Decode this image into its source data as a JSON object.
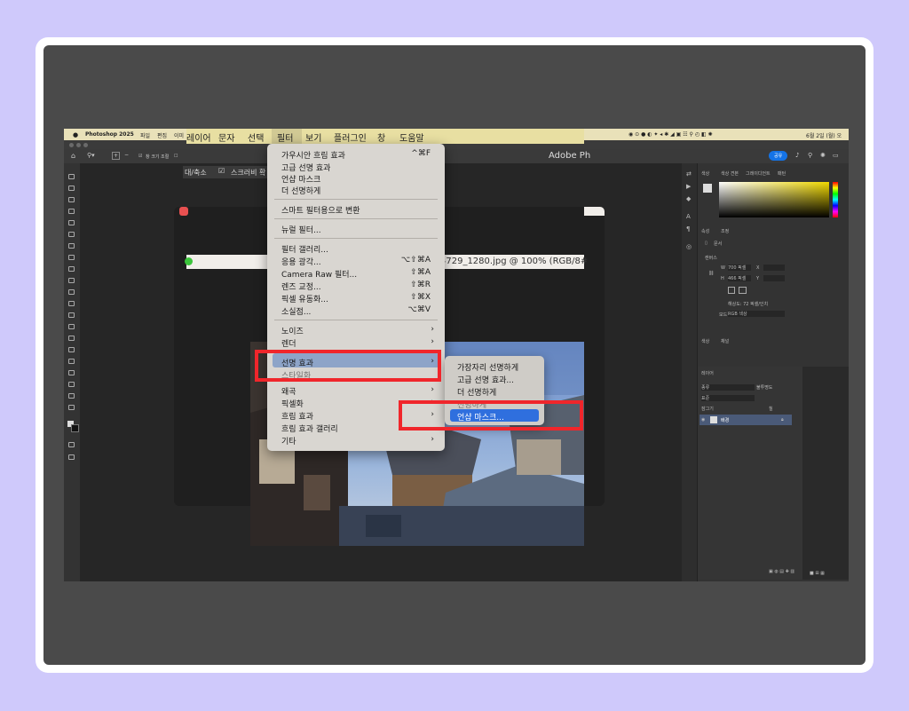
{
  "ps_menubar": {
    "app": "Photoshop 2025",
    "file": "파일",
    "edit": "편집",
    "image": "이미",
    "date": "6월 2일 (월) 오"
  },
  "big_menubar": {
    "items": [
      "레이어",
      "문자",
      "선택",
      "필터",
      "보기",
      "플러그인",
      "창",
      "도움말"
    ]
  },
  "app_title": "Adobe Ph",
  "options_bar": {
    "zoom_all": "창 크기 조절",
    "zoom_fit": "대/축소",
    "scrubby": "스크러비 확"
  },
  "document": {
    "tab_title": "4729_1280.jpg @ 100% (RGB/8#"
  },
  "share_button": "공유",
  "filter_menu": {
    "items": [
      {
        "label": "가우시안 흐림 효과",
        "shortcut": "^⌘F"
      },
      {
        "label": "고급 선명 효과",
        "shortcut": ""
      },
      {
        "label": "언샵 마스크",
        "shortcut": ""
      },
      {
        "label": "더 선명하게",
        "shortcut": ""
      },
      {
        "label": "스마트 필터용으로 변환",
        "shortcut": ""
      },
      {
        "label": "뉴럴 필터...",
        "shortcut": ""
      },
      {
        "label": "필터 갤러리...",
        "shortcut": ""
      },
      {
        "label": "응용 광각...",
        "shortcut": "⌥⇧⌘A"
      },
      {
        "label": "Camera Raw 필터...",
        "shortcut": "⇧⌘A"
      },
      {
        "label": "렌즈 교정...",
        "shortcut": "⇧⌘R"
      },
      {
        "label": "픽셀 유동화...",
        "shortcut": "⇧⌘X"
      },
      {
        "label": "소실점...",
        "shortcut": "⌥⌘V"
      },
      {
        "label": "노이즈",
        "shortcut": ""
      },
      {
        "label": "렌더",
        "shortcut": ""
      },
      {
        "label": "선명 효과",
        "shortcut": ""
      },
      {
        "label": "스타일화",
        "shortcut": ""
      },
      {
        "label": "왜곡",
        "shortcut": ""
      },
      {
        "label": "픽셀화",
        "shortcut": ""
      },
      {
        "label": "흐림 효과",
        "shortcut": ""
      },
      {
        "label": "흐림 효과 갤러리",
        "shortcut": ""
      },
      {
        "label": "기타",
        "shortcut": ""
      }
    ]
  },
  "sharpen_submenu": {
    "items": [
      "가장자리 선명하게",
      "고급 선명 효과...",
      "더 선명하게",
      "선명하게",
      "언샵 마스크..."
    ]
  },
  "right_panel": {
    "color_tabs": [
      "색상",
      "색상 견본",
      "그레이디언트",
      "패턴"
    ],
    "props_tabs": [
      "속성",
      "조정"
    ],
    "doc_label": "문서",
    "canvas_label": "캔버스",
    "width_label": "W",
    "width_value": "700 픽셀",
    "height_label": "H",
    "height_value": "466 픽셀",
    "x_label": "X",
    "y_label": "Y",
    "resolution": "해상도: 72 픽셀/인치",
    "mode_label": "모드",
    "mode_value": "RGB 색상",
    "history_tabs": [
      "색상",
      "채널"
    ],
    "layers_tab": "레이어",
    "filter_placeholder": "종류",
    "blend_mode": "표준",
    "opacity_label": "불투명도",
    "lock_label": "잠그기",
    "fill_label": "칠",
    "layer_name": "배경"
  },
  "colors": {
    "highlight": "#4c6fc2",
    "red_box": "#f0262b",
    "menubar": "#e8dfa2",
    "share": "#1473e6"
  }
}
